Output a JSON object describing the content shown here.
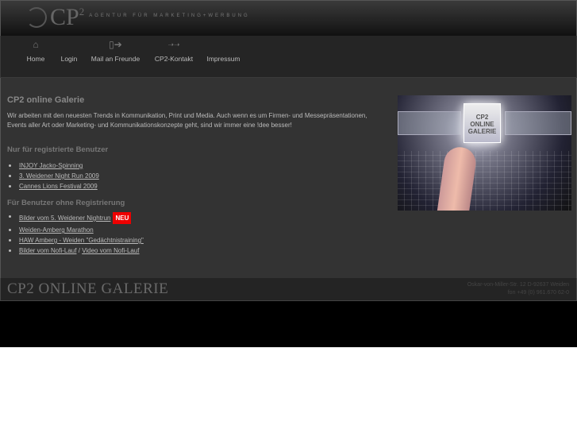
{
  "header": {
    "logo_text": "CP",
    "logo_sup": "2",
    "tagline": "AGENTUR FÜR MARKETING+WERBUNG"
  },
  "nav": [
    {
      "label": "Home",
      "icon": "home-icon"
    },
    {
      "label": "Login",
      "icon": ""
    },
    {
      "label": "Mail an Freunde",
      "icon": "mail-forward-icon"
    },
    {
      "label": "CP2-Kontakt",
      "icon": "contact-arrows-icon"
    },
    {
      "label": "Impressum",
      "icon": ""
    }
  ],
  "main": {
    "title": "CP2 online Galerie",
    "intro": "Wir arbeiten mit den neuesten Trends in Kommunikation, Print und Media. Auch wenn es um Firmen- und Messepräsentationen, Events aller Art oder Marketing- und Kommunikationskonzepte geht, sind wir immer eine !dee besser!",
    "registered_heading": "Nur für registrierte Benutzer",
    "registered_links": [
      "INJOY Jacko-Spinning",
      "3. Weidener Night Run 2009",
      "Cannes Lions Festival 2009"
    ],
    "public_heading": "Für Benutzer ohne Registrierung",
    "public_links": [
      "Bilder vom 5. Weidener Nightrun",
      "Weiden-Amberg Marathon",
      "HAW Amberg - Weiden \"Gedächtnistraining\"",
      "Bilder vom Nofi-Lauf",
      "Video vom Nofi-Lauf"
    ],
    "separator": "/",
    "new_badge": "NEU",
    "image_caption": [
      "CP2",
      "ONLINE",
      "GALERIE"
    ]
  },
  "footer": {
    "title": "CP2 ONLINE GALERIE",
    "address": "Oskar-von-Miller-Str. 12 D-92637 Weiden",
    "phone": "fon +49 (0) 961.670 62-0"
  },
  "colors": {
    "background": "#333333",
    "badge": "#ee0000"
  }
}
